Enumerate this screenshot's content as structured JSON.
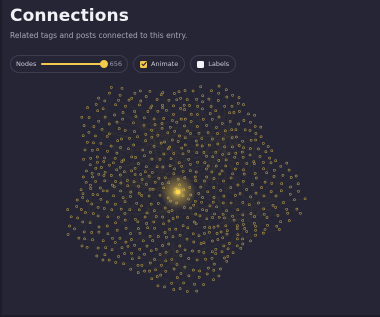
{
  "header": {
    "title": "Connections",
    "subtitle": "Related tags and posts connected to this entry."
  },
  "controls": {
    "nodes": {
      "label": "Nodes",
      "value": "656",
      "fraction": 0.98
    },
    "animate": {
      "label": "Animate",
      "checked": true
    },
    "labels": {
      "label": "Labels",
      "checked": false
    }
  },
  "graph": {
    "node_count": 656,
    "center_color": "#ffd84a",
    "node_color": "#b59a4a",
    "edge_color": "#6a5d36"
  }
}
